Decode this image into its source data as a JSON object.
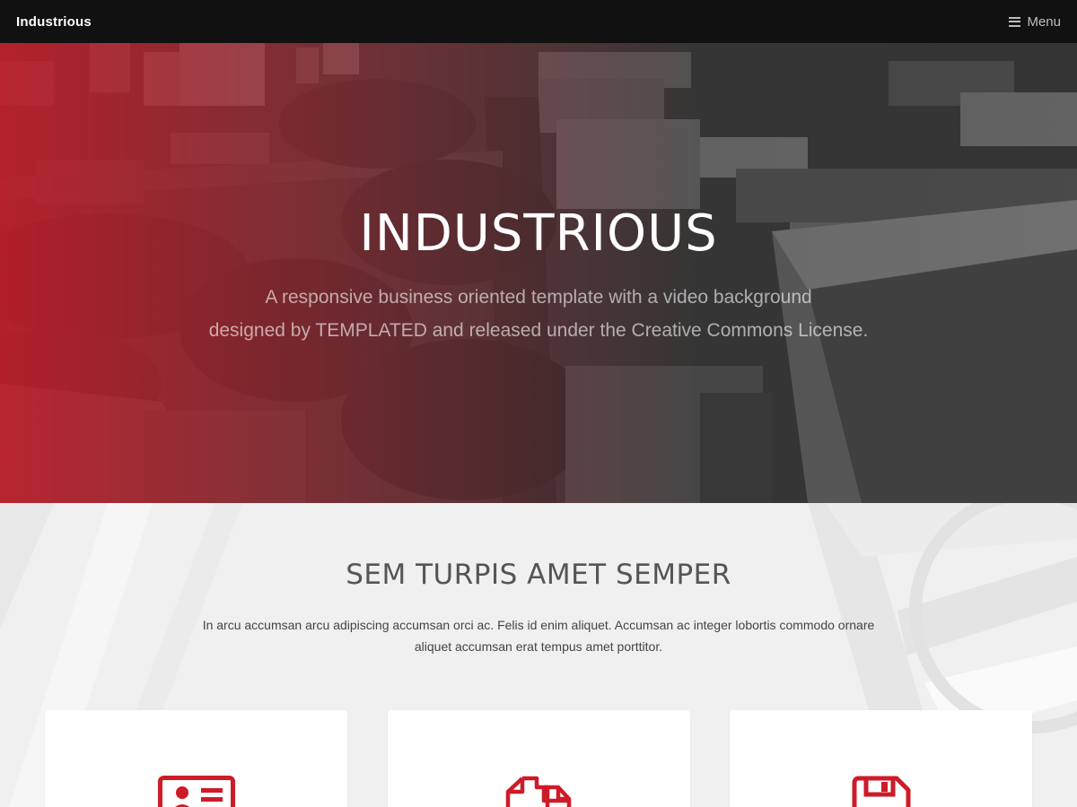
{
  "header": {
    "logo": "Industrious",
    "menu_label": "Menu",
    "menu_icon": "hamburger-icon"
  },
  "hero": {
    "title": "INDUSTRIOUS",
    "text_line1": "A responsive business oriented template with a video background",
    "text_line2": "designed by TEMPLATED and released under the Creative Commons License."
  },
  "section": {
    "title": "SEM TURPIS AMET SEMPER",
    "text_line1": "In arcu accumsan arcu adipiscing accumsan orci ac. Felis id enim aliquet. Accumsan ac integer lobortis commodo ornare",
    "text_line2": "aliquet accumsan erat tempus amet porttitor."
  },
  "cards": [
    {
      "icon": "id-card-icon"
    },
    {
      "icon": "copy-files-icon"
    },
    {
      "icon": "save-icon"
    }
  ],
  "colors": {
    "accent": "#ce1b28",
    "header_bg": "#111111",
    "section_bg": "#f2f2f2"
  }
}
